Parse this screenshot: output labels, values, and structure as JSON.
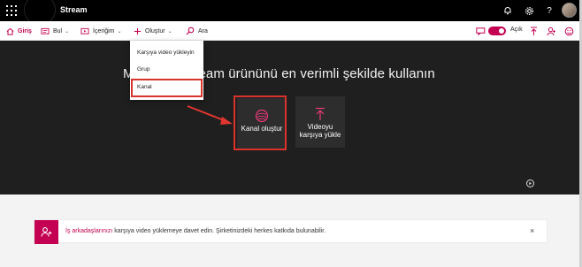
{
  "app": {
    "name": "Stream"
  },
  "nav": {
    "home": "Giriş",
    "discover": "Bul",
    "my_content": "İçeriğim",
    "create": "Oluştur",
    "search": "Ara",
    "toggle_label": "Açık"
  },
  "create_menu": {
    "items": [
      "Karşıya video yükleyin",
      "Grup",
      "Kanal"
    ]
  },
  "hero": {
    "title": "Microsoft Stream ürününü en verimli şekilde kullanın",
    "tile_create_channel": "Kanal oluştur",
    "tile_upload_video": "Videoyu karşıya yükle"
  },
  "notice": {
    "link": "İş arkadaşlarınızı",
    "text": " karşıya video yüklemeye davet edin. Şirketinizdeki herkes katkıda bulunabilir.",
    "close": "×"
  },
  "colors": {
    "accent": "#c30052",
    "highlight": "#d9332d",
    "hero_bg": "#1f1f1f"
  },
  "icons": [
    "waffle-icon",
    "bell-icon",
    "gear-icon",
    "help-icon",
    "home-icon",
    "discover-icon",
    "my-content-icon",
    "plus-icon",
    "search-icon",
    "upload-icon",
    "person-icon",
    "smiley-icon",
    "channel-icon",
    "arrow-icon",
    "invite-icon",
    "close-icon"
  ]
}
